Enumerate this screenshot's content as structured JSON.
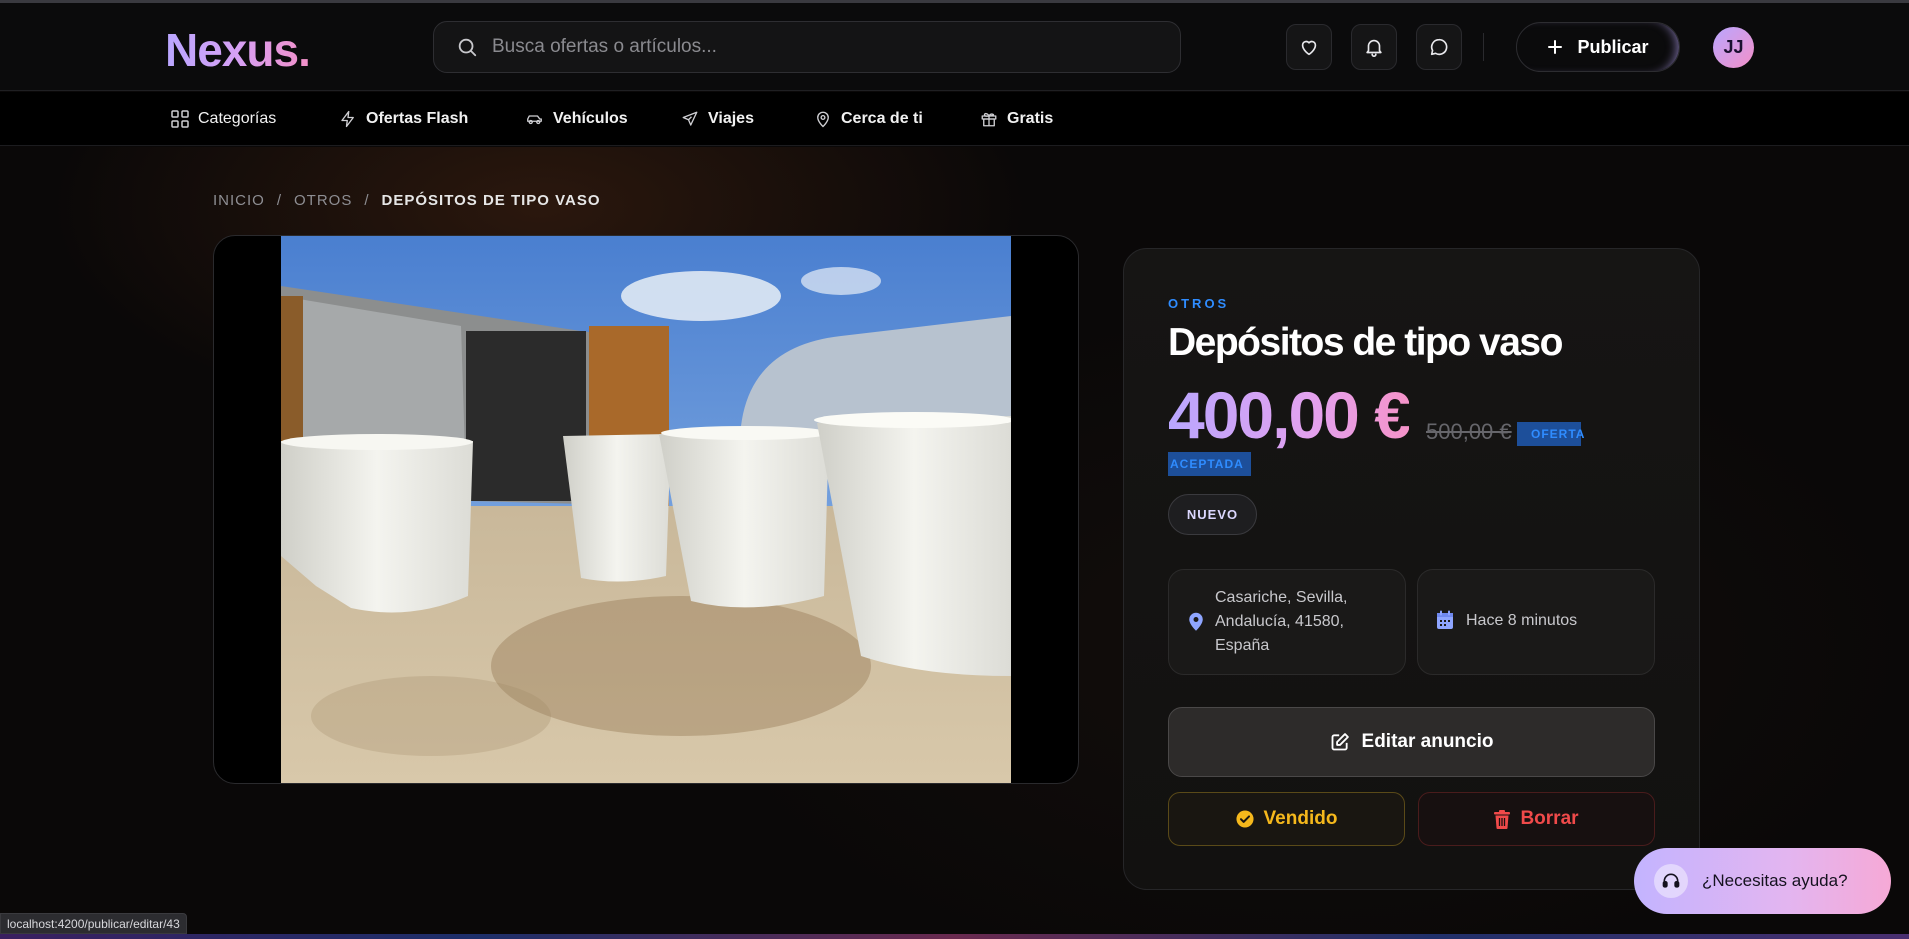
{
  "header": {
    "logo": "Nexus.",
    "search_placeholder": "Busca ofertas o artículos...",
    "publish_label": "Publicar",
    "avatar_initials": "JJ",
    "icons": [
      "heart-icon",
      "bell-icon",
      "chat-icon"
    ]
  },
  "nav": {
    "items": [
      {
        "label": "Categorías",
        "icon": "grid-icon"
      },
      {
        "label": "Ofertas Flash",
        "icon": "lightning-icon"
      },
      {
        "label": "Vehículos",
        "icon": "car-icon"
      },
      {
        "label": "Viajes",
        "icon": "plane-icon"
      },
      {
        "label": "Cerca de ti",
        "icon": "map-pin-icon"
      },
      {
        "label": "Gratis",
        "icon": "gift-icon"
      }
    ]
  },
  "breadcrumb": {
    "home": "INICIO",
    "sep": "/",
    "category": "OTROS",
    "current": "DEPÓSITOS DE TIPO VASO"
  },
  "listing": {
    "category": "OTROS",
    "title": "Depósitos de tipo vaso",
    "price": "400,00 €",
    "old_price": "500,00 €",
    "offer_label_1": "OFERTA",
    "offer_label_2": "ACEPTADA",
    "condition_badge": "NUEVO",
    "location": "Casariche, Sevilla, Andalucía, 41580, España",
    "posted": "Hace 8 minutos",
    "edit_label": "Editar anuncio",
    "sold_label": "Vendido",
    "delete_label": "Borrar"
  },
  "help": {
    "label": "¿Necesitas ayuda?"
  },
  "statusbar": {
    "url": "localhost:4200/publicar/editar/43"
  },
  "colors": {
    "accent_blue": "#2f8cff",
    "gradient_start": "#b9a6ff",
    "gradient_end": "#f593c9",
    "sold_yellow": "#f5b81c",
    "delete_red": "#f04a4a"
  }
}
